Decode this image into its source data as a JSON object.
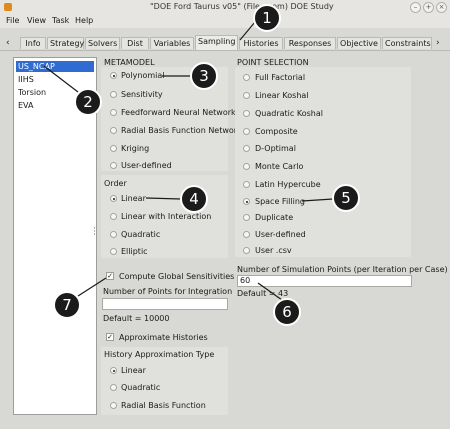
{
  "window": {
    "title": "\"DOE Ford Taurus v05\" (File: .com)  DOE Study"
  },
  "menu": [
    "File",
    "View",
    "Task",
    "Help"
  ],
  "tabs": [
    "Info",
    "Strategy",
    "Solvers",
    "Dist",
    "Variables",
    "Sampling",
    "Histories",
    "Responses",
    "Objective",
    "Constraints"
  ],
  "active_tab": "Sampling",
  "cases": [
    "US_NCAP",
    "IIHS",
    "Torsion",
    "EVA"
  ],
  "selected_case": "US_NCAP",
  "metamodel": {
    "title": "METAMODEL",
    "options": [
      "Polynomial",
      "Sensitivity",
      "Feedforward Neural Network",
      "Radial Basis Function Network",
      "Kriging",
      "User-defined"
    ],
    "selected": "Polynomial"
  },
  "order": {
    "title": "Order",
    "options": [
      "Linear",
      "Linear with Interaction",
      "Quadratic",
      "Elliptic"
    ],
    "selected": "Linear"
  },
  "global_sensitivities": {
    "label": "Compute Global Sensitivities",
    "checked": true,
    "points_label": "Number of Points for Integration",
    "points_value": "",
    "points_default": "Default = 10000"
  },
  "approx_histories": {
    "label": "Approximate Histories",
    "checked": true
  },
  "history_type": {
    "title": "History Approximation Type",
    "options": [
      "Linear",
      "Quadratic",
      "Radial Basis Function"
    ],
    "selected": "Linear"
  },
  "point_selection": {
    "title": "POINT SELECTION",
    "options": [
      "Full Factorial",
      "Linear Koshal",
      "Quadratic Koshal",
      "Composite",
      "D-Optimal",
      "Monte Carlo",
      "Latin Hypercube",
      "Space Filling",
      "Duplicate",
      "User-defined",
      "User .csv"
    ],
    "selected": "Space Filling"
  },
  "simulation_points": {
    "label": "Number of Simulation Points (per Iteration per Case)",
    "value": "60",
    "default": "Default = 43"
  },
  "callouts": [
    "1",
    "2",
    "3",
    "4",
    "5",
    "6",
    "7"
  ],
  "colors": {
    "selection": "#2f6bd1",
    "callout": "#1b1b1b",
    "panel": "#e0e0dc"
  }
}
